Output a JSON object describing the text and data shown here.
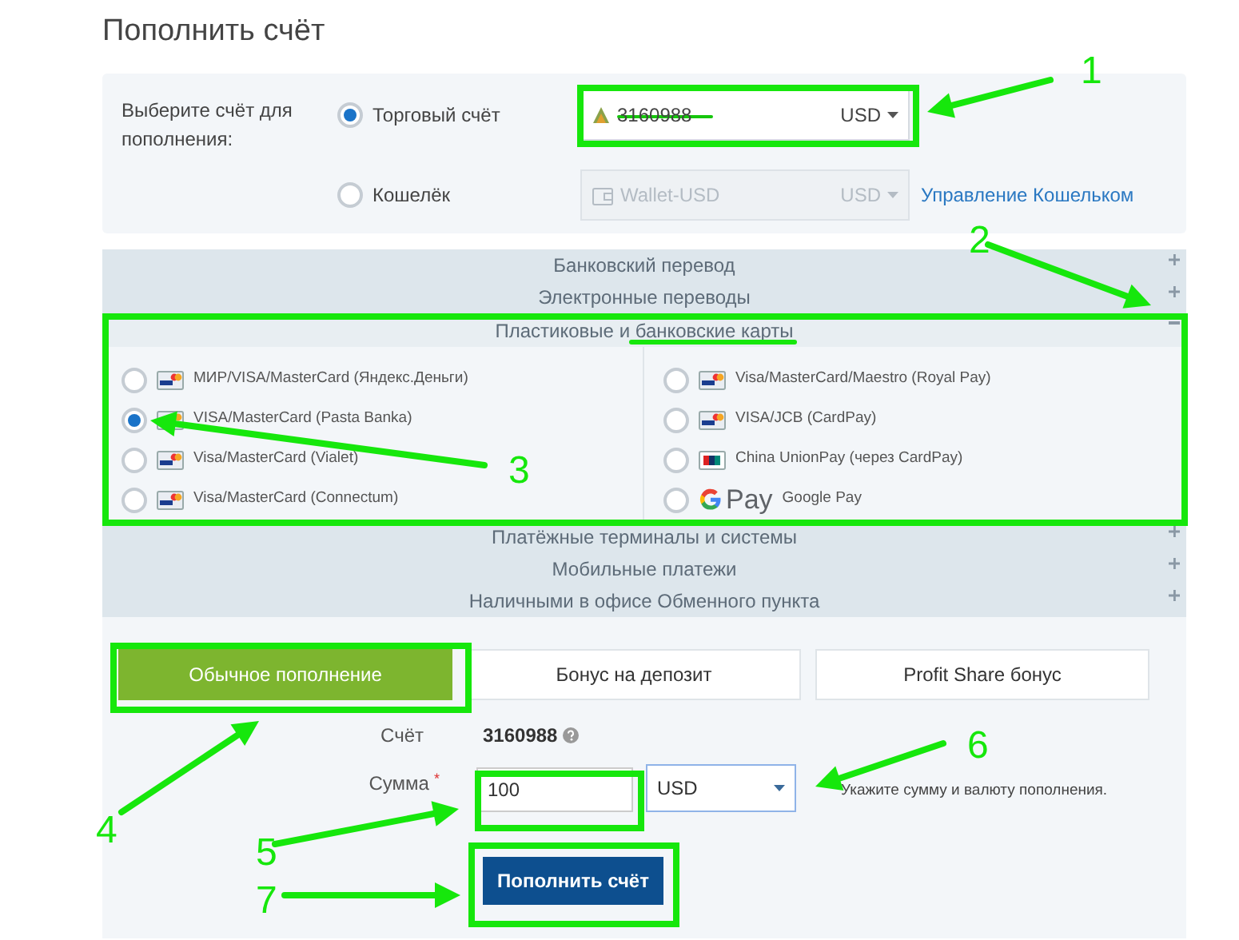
{
  "page_title": "Пополнить счёт",
  "account_panel": {
    "label": "Выберите счёт для пополнения:",
    "options": [
      {
        "label": "Торговый счёт",
        "selected": true,
        "select": {
          "value": "3160988",
          "currency": "USD",
          "disabled": false,
          "struck": true
        }
      },
      {
        "label": "Кошелёк",
        "selected": false,
        "select": {
          "value": "Wallet-USD",
          "currency": "USD",
          "disabled": true
        },
        "link": "Управление Кошельком"
      }
    ]
  },
  "methods": [
    {
      "title": "Банковский перевод",
      "expanded": false
    },
    {
      "title": "Электронные переводы",
      "expanded": false
    },
    {
      "title": "Пластиковые и банковские карты",
      "expanded": true,
      "options": [
        {
          "label": "МИР/VISA/MasterCard (Яндекс.Деньги)",
          "kind": "card",
          "selected": false
        },
        {
          "label": "VISA/MasterCard (Pasta Banka)",
          "kind": "card",
          "selected": true
        },
        {
          "label": "Visa/MasterCard (Vialet)",
          "kind": "card",
          "selected": false
        },
        {
          "label": "Visa/MasterCard (Connectum)",
          "kind": "card",
          "selected": false
        },
        {
          "label": "Visa/MasterCard/Maestro (Royal Pay)",
          "kind": "card",
          "selected": false
        },
        {
          "label": "VISA/JCB (CardPay)",
          "kind": "card",
          "selected": false
        },
        {
          "label": "China UnionPay (через CardPay)",
          "kind": "unionpay",
          "selected": false
        },
        {
          "label": "Google Pay",
          "kind": "gpay",
          "logo_text": "Pay",
          "selected": false
        }
      ]
    },
    {
      "title": "Платёжные терминалы и системы",
      "expanded": false
    },
    {
      "title": "Мобильные платежи",
      "expanded": false
    },
    {
      "title": "Наличными в офисе Обменного пункта",
      "expanded": false
    }
  ],
  "bonus_tabs": [
    {
      "label": "Обычное пополнение",
      "selected": true
    },
    {
      "label": "Бонус на депозит",
      "selected": false
    },
    {
      "label": "Profit Share бонус",
      "selected": false
    }
  ],
  "form": {
    "account_label": "Счёт",
    "account_value": "3160988",
    "amount_label": "Сумма",
    "required_mark": "*",
    "amount": "100",
    "currency": "USD",
    "hint": "Укажите сумму и валюту пополнения.",
    "submit": "Пополнить счёт"
  },
  "annotations": [
    {
      "label": "1"
    },
    {
      "label": "2"
    },
    {
      "label": "3"
    },
    {
      "label": "4"
    },
    {
      "label": "5"
    },
    {
      "label": "6"
    },
    {
      "label": "7"
    }
  ]
}
